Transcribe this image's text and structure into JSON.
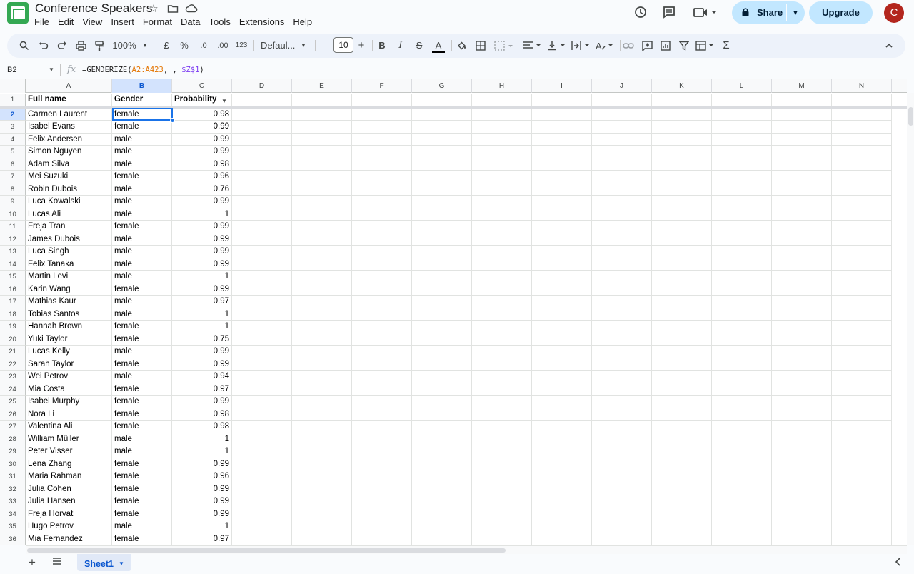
{
  "app": {
    "title": "Conference Speakers",
    "avatar_letter": "C",
    "share_label": "Share",
    "upgrade_label": "Upgrade"
  },
  "menu": [
    "File",
    "Edit",
    "View",
    "Insert",
    "Format",
    "Data",
    "Tools",
    "Extensions",
    "Help"
  ],
  "toolbar": {
    "zoom": "100%",
    "currency": "£",
    "percent": "%",
    "dec_decrease": ".0",
    "dec_increase": ".00",
    "number_format": "123",
    "font": "Defaul...",
    "font_size": "10",
    "minus": "–",
    "plus": "+",
    "bold": "B",
    "italic": "I",
    "strike": "S",
    "text_color": "A",
    "sum": "Σ"
  },
  "formula_bar": {
    "cell_ref": "B2",
    "fx": "fx",
    "formula_prefix": "=GENDERIZE(",
    "formula_range1": "A2:A423",
    "formula_mid": ", , ",
    "formula_range2": "$Z$1",
    "formula_suffix": ")"
  },
  "columns": [
    "A",
    "B",
    "C",
    "D",
    "E",
    "F",
    "G",
    "H",
    "I",
    "J",
    "K",
    "L",
    "M",
    "N"
  ],
  "header_row": [
    "Full name",
    "Gender",
    "Probability"
  ],
  "rows": [
    [
      "Carmen Laurent",
      "female",
      "0.98"
    ],
    [
      "Isabel Evans",
      "female",
      "0.99"
    ],
    [
      "Felix Andersen",
      "male",
      "0.99"
    ],
    [
      "Simon Nguyen",
      "male",
      "0.99"
    ],
    [
      "Adam Silva",
      "male",
      "0.98"
    ],
    [
      "Mei Suzuki",
      "female",
      "0.96"
    ],
    [
      "Robin Dubois",
      "male",
      "0.76"
    ],
    [
      "Luca Kowalski",
      "male",
      "0.99"
    ],
    [
      "Lucas Ali",
      "male",
      "1"
    ],
    [
      "Freja Tran",
      "female",
      "0.99"
    ],
    [
      "James Dubois",
      "male",
      "0.99"
    ],
    [
      "Luca Singh",
      "male",
      "0.99"
    ],
    [
      "Felix Tanaka",
      "male",
      "0.99"
    ],
    [
      "Martin Levi",
      "male",
      "1"
    ],
    [
      "Karin Wang",
      "female",
      "0.99"
    ],
    [
      "Mathias Kaur",
      "male",
      "0.97"
    ],
    [
      "Tobias Santos",
      "male",
      "1"
    ],
    [
      "Hannah Brown",
      "female",
      "1"
    ],
    [
      "Yuki Taylor",
      "female",
      "0.75"
    ],
    [
      "Lucas Kelly",
      "male",
      "0.99"
    ],
    [
      "Sarah Taylor",
      "female",
      "0.99"
    ],
    [
      "Wei Petrov",
      "male",
      "0.94"
    ],
    [
      "Mia Costa",
      "female",
      "0.97"
    ],
    [
      "Isabel Murphy",
      "female",
      "0.99"
    ],
    [
      "Nora Li",
      "female",
      "0.98"
    ],
    [
      "Valentina Ali",
      "female",
      "0.98"
    ],
    [
      "William Müller",
      "male",
      "1"
    ],
    [
      "Peter Visser",
      "male",
      "1"
    ],
    [
      "Lena Zhang",
      "female",
      "0.99"
    ],
    [
      "Maria Rahman",
      "female",
      "0.96"
    ],
    [
      "Julia Cohen",
      "female",
      "0.99"
    ],
    [
      "Julia Hansen",
      "female",
      "0.99"
    ],
    [
      "Freja Horvat",
      "female",
      "0.99"
    ],
    [
      "Hugo Petrov",
      "male",
      "1"
    ],
    [
      "Mia Fernandez",
      "female",
      "0.97"
    ]
  ],
  "sheet": {
    "tab_label": "Sheet1"
  },
  "colors": {
    "accent": "#0b57d0",
    "selection": "#1a73e8",
    "share_bg": "#c2e7ff",
    "logo": "#34a853",
    "avatar": "#b3261e"
  }
}
